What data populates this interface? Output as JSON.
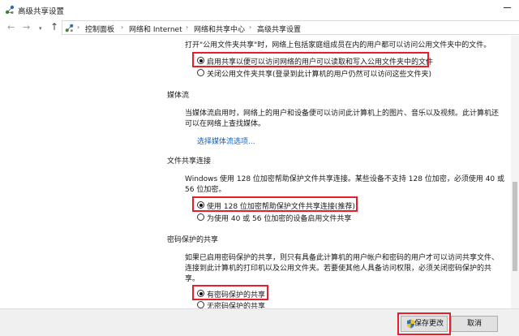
{
  "window": {
    "title": "高级共享设置"
  },
  "address": {
    "crumbs": [
      "控制面板",
      "网络和 Internet",
      "网络和共享中心",
      "高级共享设置"
    ]
  },
  "public_folder": {
    "intro": "打开\"公用文件夹共享\"时，网络上包括家庭组成员在内的用户都可以访问公用文件夹中的文件。",
    "option_on": "启用共享以便可以访问网络的用户可以读取和写入公用文件夹中的文件",
    "option_off": "关闭公用文件夹共享(登录到此计算机的用户仍然可以访问这些文件夹)"
  },
  "media": {
    "heading": "媒体流",
    "line1": "当媒体流启用时，网络上的用户和设备便可以访问此计算机上的图片、音乐以及视频。此计算机还",
    "line2": "可以在网络上查找媒体。",
    "link": "选择媒体流选项..."
  },
  "file_sharing": {
    "heading": "文件共享连接",
    "line1": "Windows 使用 128 位加密帮助保护文件共享连接。某些设备不支持 128 位加密，必须使用 40 或",
    "line2": "56 位加密。",
    "option_128": "使用 128 位加密帮助保护文件共享连接(推荐)",
    "option_40_56": "为使用 40 或 56 位加密的设备启用文件共享"
  },
  "password": {
    "heading": "密码保护的共享",
    "line1": "如果已启用密码保护的共享，则只有具备此计算机的用户帐户和密码的用户才可以访问共享文件、",
    "line2": "连接到此计算机的打印机以及公用文件夹。若要使其他人具备访问权限，必须关闭密码保护的共",
    "line3": "享。",
    "option_on": "有密码保护的共享",
    "option_off": "无密码保护的共享"
  },
  "footer": {
    "save_label": "保存更改",
    "cancel_label": "取消"
  },
  "colors": {
    "highlight": "#e5202c",
    "link": "#1560bd"
  }
}
